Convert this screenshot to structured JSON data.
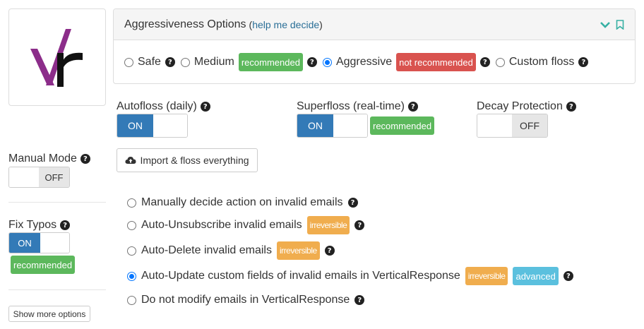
{
  "panel": {
    "title": "Aggressiveness Options",
    "help_open": "(",
    "help_link": "help me decide",
    "help_close": ")",
    "options": [
      {
        "label": "Safe",
        "selected": false
      },
      {
        "label": "Medium",
        "badge": "recommended",
        "selected": false
      },
      {
        "label": "Aggressive",
        "badge": "not recommended",
        "selected": true
      },
      {
        "label": "Custom floss",
        "selected": false
      }
    ]
  },
  "autofloss": {
    "label": "Autofloss (daily)",
    "state": "ON"
  },
  "superfloss": {
    "label": "Superfloss (real-time)",
    "state": "ON",
    "badge": "recommended"
  },
  "decay": {
    "label": "Decay Protection",
    "state": "OFF"
  },
  "manual_mode": {
    "label": "Manual Mode",
    "state": "OFF"
  },
  "import_button": {
    "label": "Import & floss everything"
  },
  "fix_typos": {
    "label": "Fix Typos",
    "state": "ON",
    "badge": "recommended"
  },
  "invalid_actions": [
    {
      "label": "Manually decide action on invalid emails",
      "selected": false
    },
    {
      "label": "Auto-Unsubscribe invalid emails",
      "badge": "irreversible",
      "selected": false
    },
    {
      "label": "Auto-Delete invalid emails",
      "badge": "irreversible",
      "selected": false
    },
    {
      "label": "Auto-Update custom fields of invalid emails in VerticalResponse",
      "badge": "irreversible",
      "badge2": "advanced",
      "selected": true
    },
    {
      "label": "Do not modify emails in VerticalResponse",
      "selected": false
    }
  ],
  "show_more": {
    "label": "Show more options"
  },
  "icons": {
    "help": "question-circle-icon",
    "collapse": "chevron-down-icon",
    "bookmark": "bookmark-icon",
    "cloud": "cloud-upload-icon"
  },
  "colors": {
    "accent": "#337ab7",
    "recommended": "#5cb85c",
    "not_recommended": "#d9534f",
    "irreversible": "#f0ad4e",
    "advanced": "#5bc0de",
    "teal": "#36b0a3"
  }
}
